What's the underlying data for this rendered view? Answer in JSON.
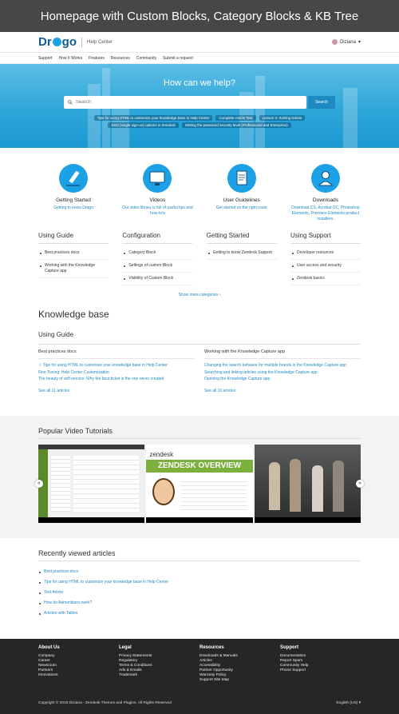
{
  "banner": {
    "title": "Homepage with Custom Blocks, Category Blocks & KB Tree"
  },
  "header": {
    "logo_left": "Dr",
    "logo_right": "go",
    "subtitle": "Help Center",
    "user": "Diziana"
  },
  "nav": [
    "Support",
    "How It Works",
    "Features",
    "Resources",
    "Community",
    "Submit a request"
  ],
  "hero": {
    "title": "How can we help?",
    "search_placeholder": "Search",
    "search_button": "Search",
    "chips": [
      "Tips for using HTML to customize your knowledge base in Help Center",
      "Complete Article Test",
      "Lesson 3: Solving tickets",
      "SSO (single sign-on) options in Zendesk",
      "Setting the password security level (Professional and Enterprise)"
    ]
  },
  "blocks": [
    {
      "icon": "pencil-icon",
      "title": "Getting Started",
      "desc": "Getting to know Drago"
    },
    {
      "icon": "video-icon",
      "title": "Videos",
      "desc": "Our video library is full of useful tips and how-to's"
    },
    {
      "icon": "document-icon",
      "title": "User Guidelines",
      "desc": "Get started on the right route"
    },
    {
      "icon": "user-icon",
      "title": "Downloads",
      "desc": "Download CS, Acrobat DC, Photoshop Elements, Premiere Elements product installers."
    }
  ],
  "categories": [
    {
      "title": "Using Guide",
      "items": [
        "Best practices docs",
        "Working with the Knowledge Capture app"
      ]
    },
    {
      "title": "Configuration",
      "items": [
        "Category Block",
        "Settings of custom Block",
        "Visibility of Custom Block"
      ]
    },
    {
      "title": "Getting Started",
      "items": [
        "Getting to know Zendesk Support"
      ]
    },
    {
      "title": "Using Support",
      "items": [
        "Developer resources",
        "User access and security",
        "Zendesk basics"
      ]
    }
  ],
  "more_categories": "Show more categories",
  "kb": {
    "title": "Knowledge base",
    "section": "Using Guide",
    "columns": [
      {
        "title": "Best practices docs",
        "articles": [
          "Tips for using HTML to customize your knowledge base in Help Center",
          "Fine Tuning: Help Center Customization",
          "The beauty of self-service: Why the best ticket is the one never created"
        ],
        "see_all": "See all 11 articles"
      },
      {
        "title": "Working with the Knowledge Capture app",
        "articles": [
          "Changing the search behavior for multiple brands in the Knowledge Capture app",
          "Searching and linking articles using the Knowledge Capture app",
          "Opening the Knowledge Capture app"
        ],
        "see_all": "See all 10 articles"
      }
    ]
  },
  "videos": {
    "title": "Popular Video Tutorials",
    "vid2_brand": "zendesk",
    "vid2_title": "ZENDESK OVERVIEW"
  },
  "recent": {
    "title": "Recently viewed articles",
    "items": [
      "Best practices docs",
      "Tips for using HTML to customize your knowledge base in Help Center",
      "Test Article",
      "How do Admonitions work?",
      "Articles with Tables"
    ]
  },
  "footer": {
    "columns": [
      {
        "title": "About Us",
        "links": [
          "Company",
          "Career",
          "Newsroom",
          "Partners",
          "Innovations"
        ]
      },
      {
        "title": "Legal",
        "links": [
          "Privacy Statements",
          "Regulatory",
          "Terms & Conditions",
          "Ads & Emails",
          "Trademark"
        ]
      },
      {
        "title": "Resources",
        "links": [
          "Downloads & Manuals",
          "Articles",
          "Accessibility",
          "Partner Opportunity",
          "Warranty Policy",
          "Support Site Map"
        ]
      },
      {
        "title": "Support",
        "links": [
          "Documentation",
          "Report Spam",
          "Community Help",
          "Phone Support"
        ]
      }
    ],
    "copyright": "Copyright © 2019 Diziana - Zendesk Themes and Plugins. All Rights Reserved",
    "language": "English (US) ▾"
  }
}
